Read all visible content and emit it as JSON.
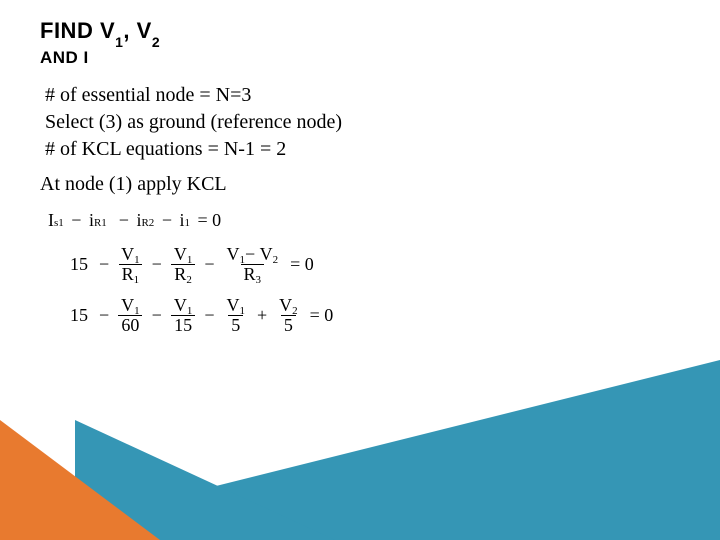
{
  "header": {
    "title_pre": "FIND V",
    "title_s1": "1",
    "title_mid": ", V",
    "title_s2": "2",
    "subtitle": "AND I"
  },
  "content": {
    "line1": "# of essential node = N=3",
    "line2": "Select (3) as ground (reference node)",
    "line3": "# of KCL equations = N-1 = 2"
  },
  "atnode": "At node (1) apply KCL",
  "eq1": {
    "Is": "I",
    "Iss": "s1",
    "m1": "−",
    "iR1": "i",
    "iR1s": "R1",
    "m2": "−",
    "iR2": "i",
    "iR2s": "R2",
    "m3": "−",
    "i1": "i",
    "i1s": "1",
    "eq": "= 0"
  },
  "eq2": {
    "lead": "15",
    "m1": "−",
    "f1n": "V",
    "f1ns": "1",
    "f1d": "R",
    "f1ds": "1",
    "m2": "−",
    "f2n": "V",
    "f2ns": "1",
    "f2d": "R",
    "f2ds": "2",
    "m3": "−",
    "f3n1": "V",
    "f3n1s": "1",
    "f3nm": "−",
    "f3n2": "V",
    "f3n2s": "2",
    "f3d": "R",
    "f3ds": "3",
    "eq": "= 0"
  },
  "eq3": {
    "lead": "15",
    "m1": "−",
    "f1n": "V",
    "f1ns": "1",
    "f1d": "60",
    "m2": "−",
    "f2n": "V",
    "f2ns": "1",
    "f2d": "15",
    "m3": "−",
    "f3n": "V",
    "f3ns": "1",
    "f3d": "5",
    "p1": "+",
    "f4n": "V",
    "f4ns": "2",
    "f4d": "5",
    "eq": "= 0"
  }
}
